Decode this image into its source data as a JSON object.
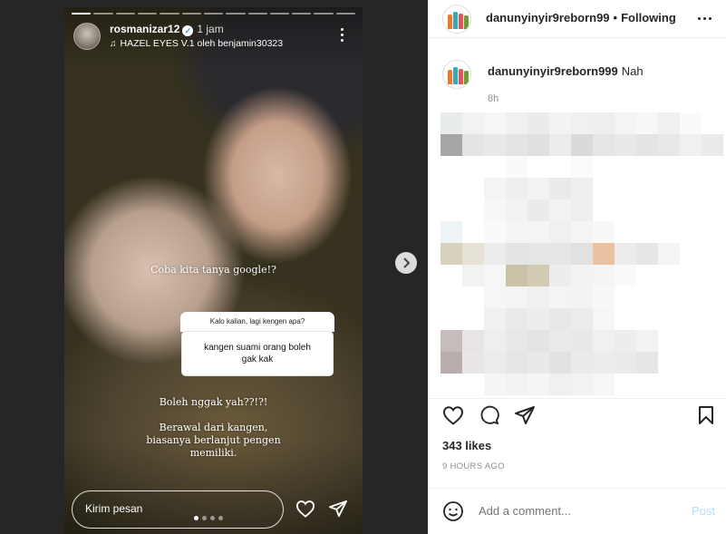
{
  "story": {
    "username": "rosmanizar12",
    "time": "1 jam",
    "music": "HAZEL EYES V.1 oleh benjamin30323",
    "caption_1": "Coba kita tanya google!?",
    "question_header": "Kalo kalian, lagi kengen apa?",
    "question_answer": "kangen suami orang boleh gak kak",
    "caption_2": "Boleh nggak yah??!?!",
    "caption_3_line1": "Berawal dari kangen,",
    "caption_3_line2": "biasanya berlanjut pengen",
    "caption_3_line3": "memiliki.",
    "reply_placeholder": "Kirim pesan",
    "segments_total": 13,
    "page_dots": 4,
    "active_dot": 1
  },
  "post": {
    "author": "danunyinyir9reborn99",
    "separator": "•",
    "follow_status": "Following",
    "caption_author": "danunyinyir9reborn999",
    "caption_text": "Nah",
    "caption_time": "8h",
    "likes": "343 likes",
    "time_ago": "9 HOURS AGO",
    "comment_placeholder": "Add a comment...",
    "post_label": "Post"
  },
  "colors": {
    "accent_blue": "#b2dffc",
    "text_dark": "#262626",
    "text_muted": "#8e8e8e"
  },
  "icons": [
    "verified-icon",
    "music-icon",
    "more-icon",
    "heart-icon",
    "send-icon",
    "comment-icon",
    "bookmark-icon",
    "emoji-icon",
    "chevron-right-icon"
  ]
}
